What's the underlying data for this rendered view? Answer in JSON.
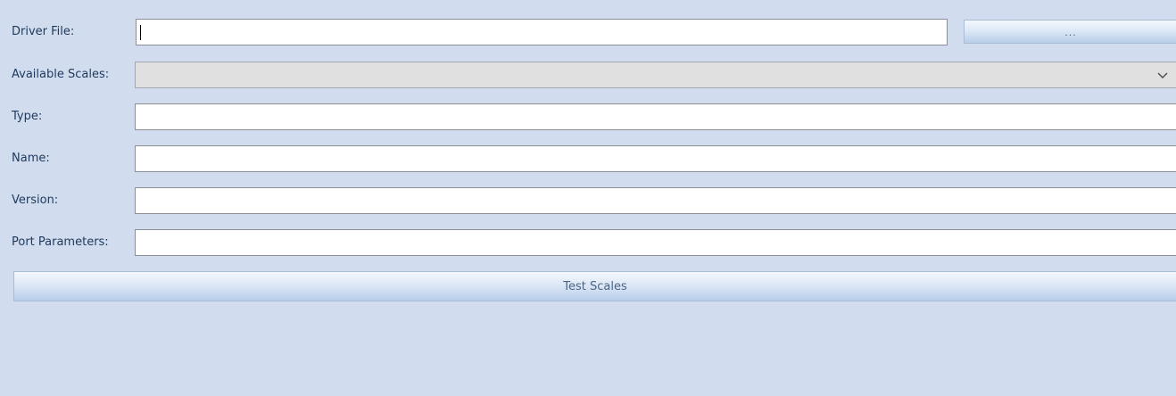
{
  "colors": {
    "panel_background": "#d1ddef",
    "field_background": "#ffffff",
    "field_border": "#8a8f96",
    "disabled_select_background": "#e0e0e0",
    "label_text": "#1e395b",
    "button_text": "#4d6582",
    "button_gradient_top": "#f4f8fd",
    "button_gradient_mid": "#dde8f6",
    "button_gradient_bottom": "#b7cde9"
  },
  "form": {
    "driver_file": {
      "label": "Driver File:",
      "value": "",
      "browse_label": "..."
    },
    "available_scales": {
      "label": "Available Scales:",
      "selected": "",
      "dropdown_icon": "chevron-down-icon"
    },
    "type": {
      "label": "Type:",
      "value": ""
    },
    "name": {
      "label": "Name:",
      "value": ""
    },
    "version": {
      "label": "Version:",
      "value": ""
    },
    "port_parameters": {
      "label": "Port Parameters:",
      "value": ""
    },
    "test_button_label": "Test Scales"
  }
}
